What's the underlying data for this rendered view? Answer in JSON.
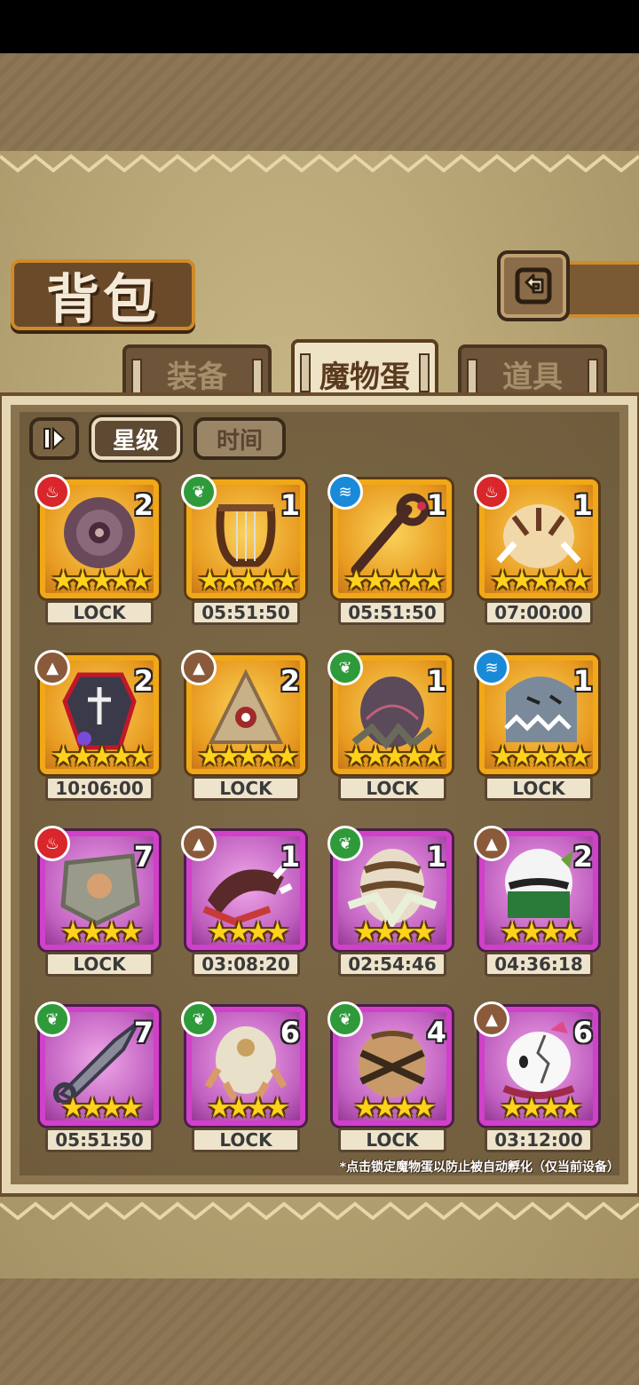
{
  "title": "背包",
  "tabs": [
    {
      "label": "装备",
      "active": false
    },
    {
      "label": "魔物蛋",
      "active": true
    },
    {
      "label": "道具",
      "active": false
    }
  ],
  "sort": {
    "toggle_icon": "sort-toggle-icon",
    "star_label": "星级",
    "time_label": "时间"
  },
  "eggs": [
    {
      "element": "fire",
      "count": "2",
      "stars": 5,
      "label": "LOCK",
      "rarity": "gold",
      "art": "dark-orb"
    },
    {
      "element": "leaf",
      "count": "1",
      "stars": 5,
      "label": "05:51:50",
      "rarity": "gold",
      "art": "lyre"
    },
    {
      "element": "water",
      "count": "1",
      "stars": 5,
      "label": "05:51:50",
      "rarity": "gold",
      "art": "staff"
    },
    {
      "element": "fire",
      "count": "1",
      "stars": 5,
      "label": "07:00:00",
      "rarity": "gold",
      "art": "tiger-egg"
    },
    {
      "element": "earth",
      "count": "2",
      "stars": 5,
      "label": "10:06:00",
      "rarity": "gold",
      "art": "coffin"
    },
    {
      "element": "earth",
      "count": "2",
      "stars": 5,
      "label": "LOCK",
      "rarity": "gold",
      "art": "pyramid"
    },
    {
      "element": "leaf",
      "count": "1",
      "stars": 5,
      "label": "LOCK",
      "rarity": "gold",
      "art": "dark-egg"
    },
    {
      "element": "water",
      "count": "1",
      "stars": 5,
      "label": "LOCK",
      "rarity": "gold",
      "art": "shark-egg"
    },
    {
      "element": "fire",
      "count": "7",
      "stars": 4,
      "label": "LOCK",
      "rarity": "purple",
      "art": "stone-shield"
    },
    {
      "element": "earth",
      "count": "1",
      "stars": 4,
      "label": "03:08:20",
      "rarity": "purple",
      "art": "horn"
    },
    {
      "element": "leaf",
      "count": "1",
      "stars": 4,
      "label": "02:54:46",
      "rarity": "purple",
      "art": "striped-egg"
    },
    {
      "element": "earth",
      "count": "2",
      "stars": 4,
      "label": "04:36:18",
      "rarity": "purple",
      "art": "panda-egg"
    },
    {
      "element": "leaf",
      "count": "7",
      "stars": 4,
      "label": "05:51:50",
      "rarity": "purple",
      "art": "kunai"
    },
    {
      "element": "leaf",
      "count": "6",
      "stars": 4,
      "label": "LOCK",
      "rarity": "purple",
      "art": "owl-egg"
    },
    {
      "element": "leaf",
      "count": "4",
      "stars": 4,
      "label": "LOCK",
      "rarity": "purple",
      "art": "bandaged-egg"
    },
    {
      "element": "earth",
      "count": "6",
      "stars": 4,
      "label": "03:12:00",
      "rarity": "purple",
      "art": "cracked-egg"
    }
  ],
  "footnote": "*点击锁定魔物蛋以防止被自动孵化（仅当前设备）",
  "colors": {
    "fire": "#d8262a",
    "leaf": "#2f9a3a",
    "water": "#1a8ad8",
    "earth": "#8a5a3a",
    "gold_frame": "#f0a818",
    "purple_frame": "#d040c8",
    "star": "#ffd21c"
  }
}
